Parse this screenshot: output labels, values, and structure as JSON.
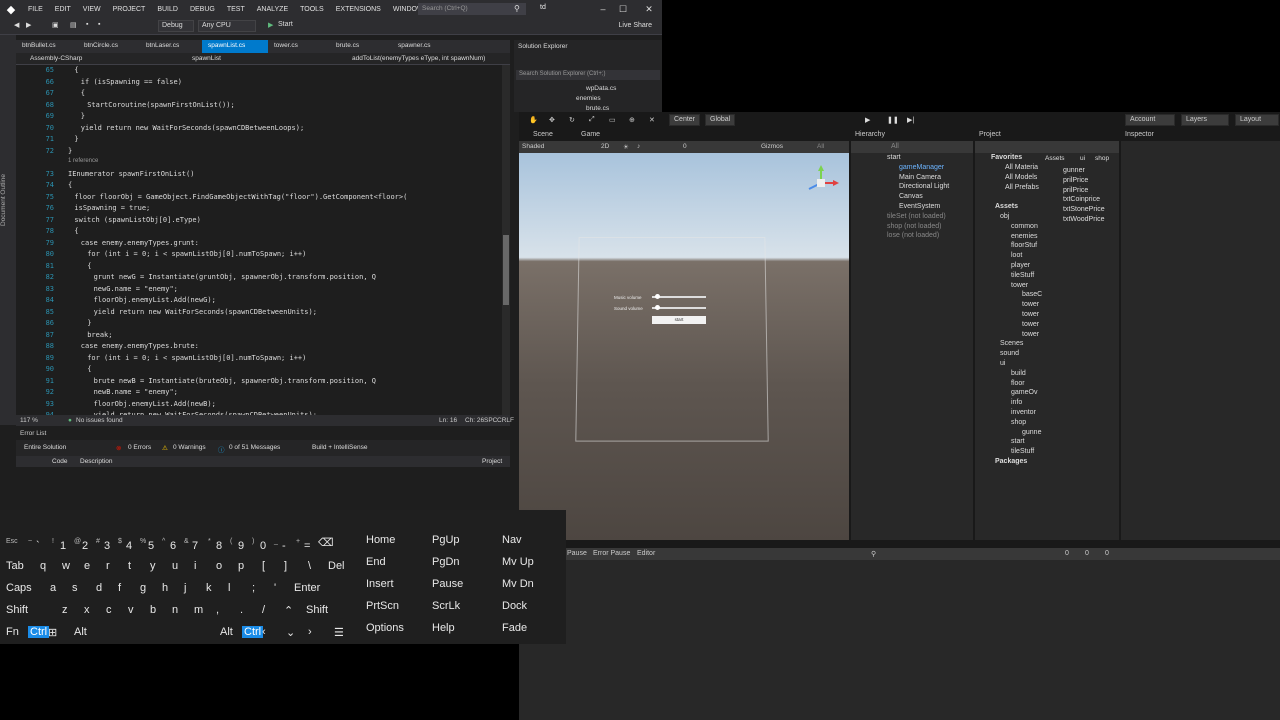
{
  "vs": {
    "menu": [
      "FILE",
      "EDIT",
      "VIEW",
      "PROJECT",
      "BUILD",
      "DEBUG",
      "TEST",
      "ANALYZE",
      "TOOLS",
      "EXTENSIONS",
      "WINDOW",
      "HELP"
    ],
    "search_placeholder": "Search (Ctrl+Q)",
    "title": "td",
    "live_share": "Live Share",
    "toolbar": {
      "config": "Debug",
      "platform": "Any CPU",
      "start": "Start"
    },
    "doc_outline": "Document Outline",
    "tabs": [
      "btnBullet.cs",
      "btnCircle.cs",
      "btnLaser.cs",
      "spawnList.cs",
      "tower.cs",
      "brute.cs",
      "spawner.cs"
    ],
    "active_tab": 3,
    "nav": {
      "project": "Assembly-CSharp",
      "class": "spawnList",
      "member": "addToList(enemyTypes eType, int spawnNum)"
    },
    "code": [
      {
        "n": "65",
        "t": "{",
        "i": 6
      },
      {
        "n": "66",
        "t": "if (isSpawning == false)",
        "i": 7
      },
      {
        "n": "67",
        "t": "{",
        "i": 7
      },
      {
        "n": "68",
        "t": "StartCoroutine(spawnFirstOnList());",
        "i": 8
      },
      {
        "n": "69",
        "t": "}",
        "i": 7
      },
      {
        "n": "70",
        "t": "yield return new WaitForSeconds(spawnCDBetweenLoops);",
        "i": 7
      },
      {
        "n": "71",
        "t": "}",
        "i": 6
      },
      {
        "n": "72",
        "t": "}",
        "i": 5
      },
      {
        "n": "",
        "t": "1 reference",
        "i": 5,
        "ref": true
      },
      {
        "n": "73",
        "t": "IEnumerator spawnFirstOnList()",
        "i": 5
      },
      {
        "n": "74",
        "t": "{",
        "i": 5
      },
      {
        "n": "75",
        "t": "floor floorObj = GameObject.FindGameObjectWithTag(\"floor\").GetComponent<floor>(",
        "i": 6
      },
      {
        "n": "76",
        "t": "isSpawning = true;",
        "i": 6
      },
      {
        "n": "77",
        "t": "switch (spawnListObj[0].eType)",
        "i": 6
      },
      {
        "n": "78",
        "t": "{",
        "i": 6
      },
      {
        "n": "79",
        "t": "case enemy.enemyTypes.grunt:",
        "i": 7
      },
      {
        "n": "80",
        "t": "for (int i = 0; i < spawnListObj[0].numToSpawn; i++)",
        "i": 8
      },
      {
        "n": "81",
        "t": "{",
        "i": 8
      },
      {
        "n": "82",
        "t": "grunt newG = Instantiate(gruntObj, spawnerObj.transform.position, Q",
        "i": 9
      },
      {
        "n": "83",
        "t": "newG.name = \"enemy\";",
        "i": 9
      },
      {
        "n": "84",
        "t": "floorObj.enemyList.Add(newG);",
        "i": 9
      },
      {
        "n": "85",
        "t": "yield return new WaitForSeconds(spawnCDBetweenUnits);",
        "i": 9
      },
      {
        "n": "86",
        "t": "}",
        "i": 8
      },
      {
        "n": "87",
        "t": "break;",
        "i": 8
      },
      {
        "n": "88",
        "t": "case enemy.enemyTypes.brute:",
        "i": 7
      },
      {
        "n": "89",
        "t": "for (int i = 0; i < spawnListObj[0].numToSpawn; i++)",
        "i": 8
      },
      {
        "n": "90",
        "t": "{",
        "i": 8
      },
      {
        "n": "91",
        "t": "brute newB = Instantiate(bruteObj, spawnerObj.transform.position, Q",
        "i": 9
      },
      {
        "n": "92",
        "t": "newB.name = \"enemy\";",
        "i": 9
      },
      {
        "n": "93",
        "t": "floorObj.enemyList.Add(newB);",
        "i": 9
      },
      {
        "n": "94",
        "t": "yield return new WaitForSeconds(spawnCDBetweenUnits);",
        "i": 9
      }
    ],
    "status": {
      "zoom": "117 %",
      "issues": "No issues found",
      "ln": "Ln: 16",
      "ch": "Ch: 26",
      "spc": "SPC",
      "crlf": "CRLF"
    },
    "error_list": {
      "title": "Error List",
      "scope": "Entire Solution",
      "errors": "0 Errors",
      "warnings": "0 Warnings",
      "messages": "0 of 51 Messages",
      "build": "Build + IntelliSense",
      "col_code": "Code",
      "col_desc": "Description",
      "col_project": "Project"
    },
    "solution": {
      "title": "Solution Explorer",
      "search": "Search Solution Explorer (Ctrl+;)",
      "items": [
        "wpData.cs",
        "enemies",
        "brute.cs"
      ]
    }
  },
  "unity": {
    "toolbar": {
      "center": "Center",
      "global": "Global",
      "account": "Account",
      "layers": "Layers",
      "layout": "Layout"
    },
    "scene_tabs": {
      "scene": "Scene",
      "game": "Game"
    },
    "scene_tool": {
      "shaded": "Shaded",
      "mode2d": "2D",
      "gizmos": "Gizmos",
      "all": "All",
      "zero": "0"
    },
    "game_ui": {
      "music": "Music volume",
      "sound": "Sound volume",
      "start": "start",
      "music_level": 0.1,
      "sound_level": 0.1
    },
    "hierarchy": {
      "title": "Hierarchy",
      "search": "All",
      "items": [
        {
          "label": "start",
          "depth": 0
        },
        {
          "label": "gameManager",
          "depth": 1,
          "sel": true
        },
        {
          "label": "Main Camera",
          "depth": 1
        },
        {
          "label": "Directional Light",
          "depth": 1
        },
        {
          "label": "Canvas",
          "depth": 1
        },
        {
          "label": "EventSystem",
          "depth": 1
        },
        {
          "label": "tileSet (not loaded)",
          "depth": 0,
          "dim": true
        },
        {
          "label": "shop (not loaded)",
          "depth": 0,
          "dim": true
        },
        {
          "label": "lose (not loaded)",
          "depth": 0,
          "dim": true
        }
      ]
    },
    "project": {
      "title": "Project",
      "breadcrumb": [
        "Assets",
        "ui",
        "shop"
      ],
      "favorites_title": "Favorites",
      "favorites": [
        "All Materia",
        "All Models",
        "All Prefabs"
      ],
      "assets_title": "Assets",
      "tree": [
        {
          "label": "obj",
          "depth": 1
        },
        {
          "label": "common",
          "depth": 2
        },
        {
          "label": "enemies",
          "depth": 2
        },
        {
          "label": "floorStuf",
          "depth": 2
        },
        {
          "label": "loot",
          "depth": 2
        },
        {
          "label": "player",
          "depth": 2
        },
        {
          "label": "tileStuff",
          "depth": 2
        },
        {
          "label": "tower",
          "depth": 2
        },
        {
          "label": "baseC",
          "depth": 3
        },
        {
          "label": "tower",
          "depth": 3
        },
        {
          "label": "tower",
          "depth": 3
        },
        {
          "label": "tower",
          "depth": 3
        },
        {
          "label": "tower",
          "depth": 3
        },
        {
          "label": "Scenes",
          "depth": 1
        },
        {
          "label": "sound",
          "depth": 1
        },
        {
          "label": "ui",
          "depth": 1
        },
        {
          "label": "build",
          "depth": 2
        },
        {
          "label": "floor",
          "depth": 2
        },
        {
          "label": "gameOv",
          "depth": 2
        },
        {
          "label": "info",
          "depth": 2
        },
        {
          "label": "inventor",
          "depth": 2
        },
        {
          "label": "shop",
          "depth": 2
        },
        {
          "label": "gunne",
          "depth": 3
        },
        {
          "label": "start",
          "depth": 2
        },
        {
          "label": "tileStuff",
          "depth": 2
        }
      ],
      "packages": "Packages",
      "files": [
        "gunner",
        "prilPrice",
        "prilPrice",
        "txtCoinprice",
        "txtStonePrice",
        "txtWoodPrice"
      ]
    },
    "inspector": {
      "title": "Inspector"
    },
    "console": {
      "pause": "Pause",
      "error_pause": "Error Pause",
      "editor": "Editor",
      "c0": "0",
      "c1": "0",
      "c2": "0"
    }
  },
  "keyboard": {
    "row0": [
      {
        "s": "Esc",
        "m": ""
      },
      {
        "s": "~",
        "m": "`"
      },
      {
        "s": "!",
        "m": "1"
      },
      {
        "s": "@",
        "m": "2"
      },
      {
        "s": "#",
        "m": "3"
      },
      {
        "s": "$",
        "m": "4"
      },
      {
        "s": "%",
        "m": "5"
      },
      {
        "s": "^",
        "m": "6"
      },
      {
        "s": "&",
        "m": "7"
      },
      {
        "s": "*",
        "m": "8"
      },
      {
        "s": "(",
        "m": "9"
      },
      {
        "s": ")",
        "m": "0"
      },
      {
        "s": "_",
        "m": "-"
      },
      {
        "s": "+",
        "m": "="
      }
    ],
    "row1": [
      "Tab",
      "q",
      "w",
      "e",
      "r",
      "t",
      "y",
      "u",
      "i",
      "o",
      "p",
      "[",
      "]",
      "\\",
      "Del"
    ],
    "row2": [
      "Caps",
      "a",
      "s",
      "d",
      "f",
      "g",
      "h",
      "j",
      "k",
      "l",
      ";",
      "'",
      "Enter"
    ],
    "row3": [
      "Shift",
      "z",
      "x",
      "c",
      "v",
      "b",
      "n",
      "m",
      ",",
      ".",
      "/",
      "Shift"
    ],
    "row4": [
      "Fn",
      "Ctrl",
      "Alt",
      "Alt",
      "Ctrl"
    ],
    "nav": [
      [
        "Home",
        "PgUp",
        "Nav"
      ],
      [
        "End",
        "PgDn",
        "Mv Up"
      ],
      [
        "Insert",
        "Pause",
        "Mv Dn"
      ],
      [
        "PrtScn",
        "ScrLk",
        "Dock"
      ],
      [
        "Options",
        "Help",
        "Fade"
      ]
    ]
  }
}
